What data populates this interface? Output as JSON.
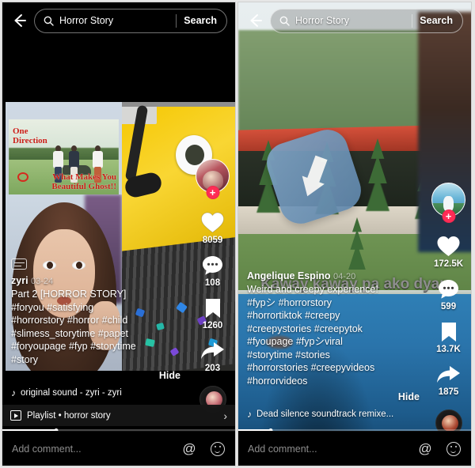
{
  "panels": [
    {
      "id": "left",
      "search": {
        "query": "Horror Story",
        "search_label": "Search",
        "back_icon": "back-arrow-icon",
        "magnifier_icon": "search-icon"
      },
      "post": {
        "username": "zyri",
        "date": "03-24",
        "caption_title": "Part 2 [HORROR STORY]",
        "tags_lines": [
          "#foryou #satisfying",
          "#horrorstory #horror #child",
          "#slimess_storytime #papet",
          "#foryoupage #fyp #storytime",
          "#story"
        ],
        "hide_label": "Hide",
        "sound": "original sound - zyri - zyri",
        "sound_icon": "music-note-icon",
        "cc_icon": "subtitles-icon"
      },
      "actions": {
        "avatar_name": "creator-avatar",
        "follow_label": "+",
        "like_count": "8059",
        "comment_count": "108",
        "bookmark_count": "1260",
        "share_count": "203"
      },
      "playlist": {
        "label": "Playlist • horror story",
        "icon": "playlist-icon",
        "chevron": "›"
      },
      "progress_percent": 23,
      "comment_bar": {
        "placeholder": "Add comment...",
        "mention_icon": "@",
        "emoji_icon": "emoji-icon"
      }
    },
    {
      "id": "right",
      "search": {
        "query": "Horror Story",
        "search_label": "Search",
        "back_icon": "back-arrow-icon",
        "magnifier_icon": "search-icon"
      },
      "post": {
        "username": "Angelique Espino",
        "date": "04-20",
        "caption_title": "Weird and creepy experience!",
        "tags_lines": [
          "#fypシ #horrorstory",
          "#horrortiktok #creepy",
          "#creepystories #creepytok",
          "#fyoupage #fypシviral",
          "#storytime #stories",
          "#horrorstories #creepyvideos",
          "#horrorvideos"
        ],
        "hide_label": "Hide",
        "sound": "Dead silence soundtrack remixe...",
        "sound_icon": "music-note-icon",
        "overlay_text": "Kaway kaway pa ako dyan"
      },
      "actions": {
        "avatar_name": "creator-avatar",
        "follow_label": "+",
        "like_count": "172.5K",
        "comment_count": "599",
        "bookmark_count": "13.7K",
        "share_count": "1875"
      },
      "progress_percent": 14,
      "comment_bar": {
        "placeholder": "Add comment...",
        "mention_icon": "@",
        "emoji_icon": "emoji-icon"
      }
    }
  ],
  "artwork": {
    "left_meme_line1": "One",
    "left_meme_line2": "Direction",
    "left_meme_line3": "What Makes You",
    "left_meme_line4": "Beautiful Ghost!!"
  },
  "colors": {
    "accent_red": "#fe2c55",
    "background": "#000000",
    "text": "#ffffff"
  }
}
